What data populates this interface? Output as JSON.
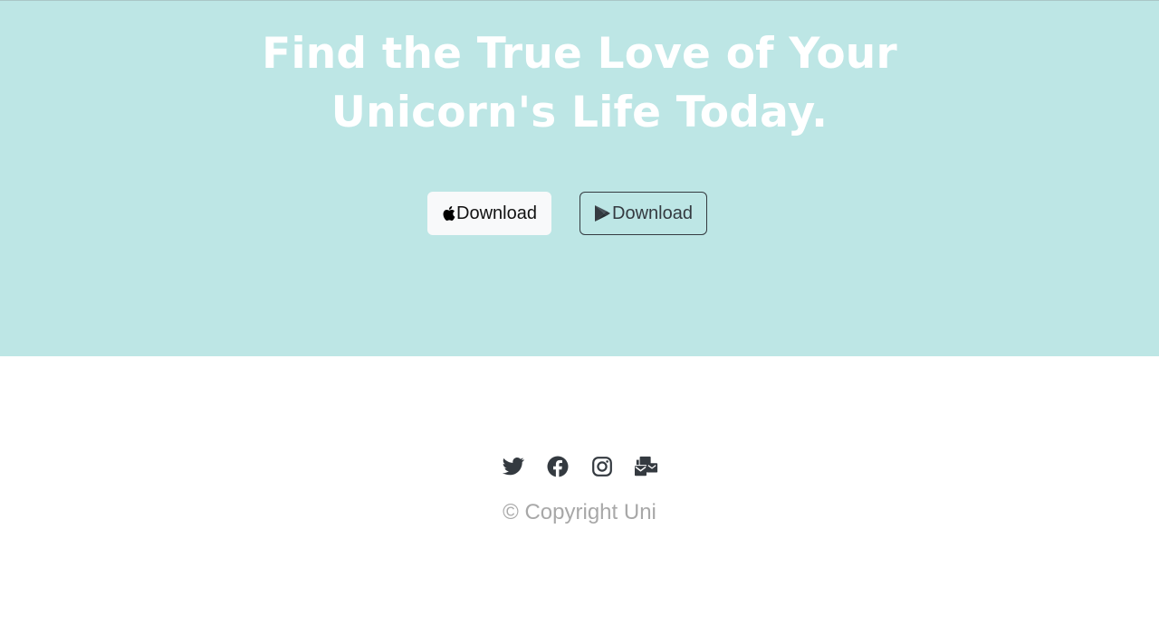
{
  "hero": {
    "title": "Find the True Love of Your Unicorn's Life Today.",
    "background_color": "#bde6e5",
    "buttons": [
      {
        "label": "Download",
        "icon": "apple-icon"
      },
      {
        "label": "Download",
        "icon": "google-play-icon"
      }
    ]
  },
  "footer": {
    "social_icons": [
      "twitter-icon",
      "facebook-icon",
      "instagram-icon",
      "mail-bulk-icon"
    ],
    "icon_color": "#343a40",
    "copyright": "© Copyright Uni"
  }
}
